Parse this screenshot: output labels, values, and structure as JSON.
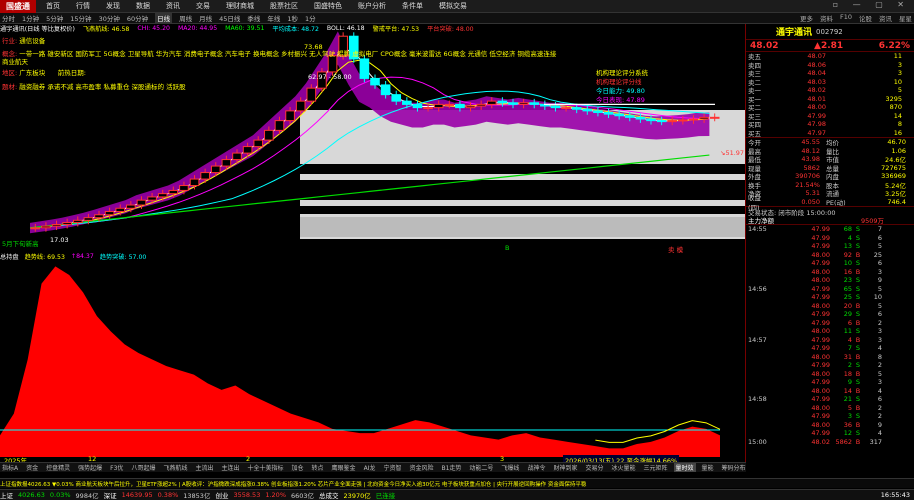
{
  "app": {
    "logo": "国盛通",
    "menus": [
      "首页",
      "行情",
      "发现",
      "数据",
      "资讯",
      "交易",
      "理财商城",
      "股票社区",
      "国盛特色",
      "账户分析",
      "条件单",
      "模拟交易"
    ],
    "controls": "▫ — ▢ ✕"
  },
  "periods": [
    "分时",
    "1分钟",
    "5分钟",
    "15分钟",
    "30分钟",
    "60分钟",
    "日线",
    "周线",
    "月线",
    "45日线",
    "季线",
    "年线",
    "1秒",
    "1分"
  ],
  "active_period": "日线",
  "right_buttons": [
    "更多",
    "资料",
    "F10",
    "论股",
    "资讯",
    "星星"
  ],
  "ma": [
    {
      "text": "通宇通讯(日线 等比复权价)",
      "color": "#ffffff"
    },
    {
      "text": "飞燕航线: 46.58",
      "color": "#ffff00"
    },
    {
      "text": "CHI: 45.20",
      "color": "#ff00ff"
    },
    {
      "text": "MA20: 44.95",
      "color": "#ff00ff"
    },
    {
      "text": "MA60: 39.51",
      "color": "#00ff00"
    },
    {
      "text": "平均成本: 48.72",
      "color": "#00ffff"
    },
    {
      "text": "BOLL: 46.18",
      "color": "#ffffff"
    },
    {
      "text": "警戒平台: 47.53",
      "color": "#ffff00"
    },
    {
      "text": "平台突破: 48.00",
      "color": "#ff3333"
    }
  ],
  "notes": {
    "industry_label": "行业:",
    "industry": "通信设备",
    "concept_label": "概念:",
    "concept": "一带一路 雄安新区 国防军工 5G概念 卫星导航 华为汽车 消费电子概念 汽车电子 换电概念 乡村振兴 无人驾驶 鲲鹏 虚拟电厂 CPO概念 毫米波雷达 6G概念 光通信 低空经济 铜缆高速连接 商业航天",
    "region_label": "地区:",
    "region": "广东板块",
    "hot_label": "前热日期:",
    "hot": "",
    "theme_label": "题材:",
    "theme": "融资融券 承诺不减 高市盈率 私募重仓 深股通标的 活跃股",
    "eval_title": "机构理论评分系统",
    "eval_line1": "今日能力: 49.80",
    "eval_line2": "今日表现: 47.89",
    "peak": "73.68",
    "mid": "62.97 - 58.00",
    "low": "17.03",
    "right_tag": "↘51.97",
    "buy_mark": "B",
    "sell_mark": "卖 模",
    "low_left": "5月下旬新高"
  },
  "y_axis_top": [
    "73.68",
    "69.00",
    "64.00",
    "62.88",
    "59.00",
    "54.00",
    "49.00",
    "44.00",
    "39.00",
    "34.00",
    "29.00",
    "24.00",
    "19.00",
    "14.00",
    "9.00"
  ],
  "y_axis_bottom": [
    "90.00",
    "80.00",
    "70.00",
    "60.00",
    "50.00",
    "40.00",
    "30.00",
    "20.00",
    "10.00"
  ],
  "indicator": [
    {
      "text": "总持盘",
      "color": "#ffffff"
    },
    {
      "text": "趋势线: 69.53",
      "color": "#ffff00"
    },
    {
      "text": "↑84.37",
      "color": "#ff00ff"
    },
    {
      "text": "趋势突破: 57.00",
      "color": "#00ffff"
    }
  ],
  "x_dates": [
    "2025年",
    "12",
    "2",
    "3",
    "4"
  ],
  "date_tag": "2026/03/13(五) 22 至今涨幅14.66%",
  "stock": {
    "name": "通宇通讯",
    "code": "002792",
    "price": "48.02",
    "change": "▲2.81",
    "pct": "6.22%"
  },
  "orderbook": [
    {
      "label": "卖五",
      "price": "48.07",
      "vol": "11"
    },
    {
      "label": "卖四",
      "price": "48.06",
      "vol": "3"
    },
    {
      "label": "卖三",
      "price": "48.04",
      "vol": "3"
    },
    {
      "label": "卖二",
      "price": "48.03",
      "vol": "10"
    },
    {
      "label": "卖一",
      "price": "48.02",
      "vol": "5"
    },
    {
      "label": "买一",
      "price": "48.01",
      "vol": "3295"
    },
    {
      "label": "买二",
      "price": "48.00",
      "vol": "870"
    },
    {
      "label": "买三",
      "price": "47.99",
      "vol": "14"
    },
    {
      "label": "买四",
      "price": "47.98",
      "vol": "8"
    },
    {
      "label": "买五",
      "price": "47.97",
      "vol": "16"
    }
  ],
  "stats": [
    {
      "a": "今开",
      "b": "45.55",
      "c": "均价",
      "d": "46.70"
    },
    {
      "a": "最高",
      "b": "48.12",
      "c": "量比",
      "d": "1.06"
    },
    {
      "a": "最低",
      "b": "43.98",
      "c": "市值",
      "d": "24.6亿"
    },
    {
      "a": "现量",
      "b": "5862",
      "c": "总量",
      "d": "727675"
    },
    {
      "a": "外盘",
      "b": "390706",
      "c": "内盘",
      "d": "336969"
    },
    {
      "a": "换手",
      "b": "21.54%",
      "c": "股本",
      "d": "5.24亿"
    },
    {
      "a": "净资",
      "b": "5.31",
      "c": "流通",
      "d": "3.25亿"
    },
    {
      "a": "收益(四)",
      "b": "0.050",
      "c": "PE(动)",
      "d": "746.4"
    }
  ],
  "trade_status": "交易状态: 闭市阶段 15:00:00",
  "main_net": "主力净额",
  "main_net_val": "9509万",
  "ticks": [
    {
      "t": "14:55",
      "p": "47.99",
      "f": "68",
      "v": "S",
      "n": "7"
    },
    {
      "t": "",
      "p": "47.99",
      "f": "4",
      "v": "S",
      "n": "6"
    },
    {
      "t": "",
      "p": "47.99",
      "f": "13",
      "v": "S",
      "n": "5"
    },
    {
      "t": "",
      "p": "48.00",
      "f": "92",
      "v": "B",
      "n": "25"
    },
    {
      "t": "",
      "p": "47.99",
      "f": "10",
      "v": "S",
      "n": "6"
    },
    {
      "t": "",
      "p": "48.00",
      "f": "16",
      "v": "B",
      "n": "3"
    },
    {
      "t": "",
      "p": "48.00",
      "f": "23",
      "v": "S",
      "n": "9"
    },
    {
      "t": "14:56",
      "p": "47.99",
      "f": "65",
      "v": "S",
      "n": "5"
    },
    {
      "t": "",
      "p": "47.99",
      "f": "25",
      "v": "S",
      "n": "10"
    },
    {
      "t": "",
      "p": "48.00",
      "f": "20",
      "v": "B",
      "n": "5"
    },
    {
      "t": "",
      "p": "47.99",
      "f": "29",
      "v": "S",
      "n": "6"
    },
    {
      "t": "",
      "p": "47.99",
      "f": "6",
      "v": "B",
      "n": "2"
    },
    {
      "t": "",
      "p": "48.00",
      "f": "11",
      "v": "S",
      "n": "3"
    },
    {
      "t": "14:57",
      "p": "47.99",
      "f": "4",
      "v": "B",
      "n": "3"
    },
    {
      "t": "",
      "p": "47.99",
      "f": "7",
      "v": "S",
      "n": "4"
    },
    {
      "t": "",
      "p": "48.00",
      "f": "31",
      "v": "B",
      "n": "8"
    },
    {
      "t": "",
      "p": "47.99",
      "f": "2",
      "v": "S",
      "n": "2"
    },
    {
      "t": "",
      "p": "48.00",
      "f": "18",
      "v": "B",
      "n": "5"
    },
    {
      "t": "",
      "p": "47.99",
      "f": "9",
      "v": "S",
      "n": "3"
    },
    {
      "t": "",
      "p": "48.00",
      "f": "14",
      "v": "B",
      "n": "4"
    },
    {
      "t": "14:58",
      "p": "47.99",
      "f": "21",
      "v": "S",
      "n": "6"
    },
    {
      "t": "",
      "p": "48.00",
      "f": "5",
      "v": "B",
      "n": "2"
    },
    {
      "t": "",
      "p": "47.99",
      "f": "3",
      "v": "S",
      "n": "2"
    },
    {
      "t": "",
      "p": "48.00",
      "f": "36",
      "v": "B",
      "n": "9"
    },
    {
      "t": "",
      "p": "47.99",
      "f": "12",
      "v": "S",
      "n": "4"
    },
    {
      "t": "15:00",
      "p": "48.02",
      "f": "5862",
      "v": "B",
      "n": "317"
    }
  ],
  "tabs": [
    "指标A",
    "资金",
    "控盘精灵",
    "强势起爆",
    "F3优",
    "八哥起爆",
    "飞燕航线",
    "主流出",
    "主连出",
    "十全十美指标",
    "加仓",
    "转点",
    "鹰眼鉴金",
    "AI龙",
    "宁资智",
    "资金风险",
    "B1走势",
    "动能二号",
    "飞爆线",
    "战神令",
    "财神到家",
    "交易分",
    "冰火量能",
    "三元矩阵",
    "量时效",
    "量能",
    "筹码分布",
    "MAC",
    "副图公式1",
    "指标公式",
    "月线量能",
    "金叉",
    "专家指标",
    "日线"
  ],
  "active_tab": "量时效",
  "ticker": "上证指数报4026.63 ▼0.03% 商业航天板块午后拉升，卫星ETF涨超2%  |  A股收评：沪指微跌深成指涨0.38% 创业板指涨1.20% 芯片产业全面走强  |  北向资金今日净买入逾30亿元 电子板块获重点加仓  |  央行开展逆回购操作 资金面保持平稳",
  "indices": [
    {
      "name": "上证",
      "val": "4026.63",
      "chg": "0.03%",
      "color": "#0d0"
    },
    {
      "name": "",
      "val": "9984亿",
      "chg": "",
      "color": "#ccc"
    },
    {
      "name": "深证",
      "val": "14639.95",
      "chg": "0.38%",
      "color": "#f33"
    },
    {
      "name": "",
      "val": "13853亿",
      "chg": "",
      "color": "#ccc"
    },
    {
      "name": "创业",
      "val": "3558.53",
      "chg": "1.20%",
      "color": "#f33"
    },
    {
      "name": "",
      "val": "6603亿",
      "chg": "",
      "color": "#ccc"
    },
    {
      "name": "总成交",
      "val": "23970亿",
      "chg": "",
      "color": "#ff0"
    },
    {
      "name": "",
      "val": "已连接",
      "chg": "",
      "color": "#0d0"
    }
  ],
  "clock": "16:55:43",
  "chart_data": {
    "type": "candlestick+area",
    "title": "通宇通讯(日线 等比复权价)",
    "price_range": [
      9,
      73.68
    ],
    "indicator_range": [
      0,
      90
    ],
    "price_close": [
      14,
      14.5,
      15,
      15.6,
      16.3,
      17.1,
      18,
      19,
      20,
      21,
      22.5,
      23.5,
      24.5,
      25.5,
      27,
      29,
      31,
      33,
      35,
      37,
      39,
      41,
      44,
      47,
      50,
      53,
      57,
      62,
      67,
      73,
      66,
      60,
      58,
      55,
      53,
      52,
      51,
      51,
      52,
      52,
      51,
      51.5,
      52,
      53,
      52.5,
      52,
      52.5,
      52,
      51.5,
      51,
      51,
      50.5,
      50,
      49.5,
      49,
      48.5,
      48,
      47.5,
      47,
      46.8,
      47,
      47.2,
      47.5,
      48,
      48.02
    ],
    "trend_line": [
      10,
      20,
      45,
      80,
      88,
      84,
      76,
      65,
      58,
      52,
      48,
      45,
      42,
      40,
      38,
      34,
      31,
      33,
      29,
      26,
      23,
      20,
      18,
      16,
      13,
      12,
      11,
      11,
      13,
      15,
      17,
      16,
      14,
      12,
      10,
      9,
      8,
      10,
      11,
      9,
      8,
      7,
      6,
      5,
      4,
      4,
      6,
      7,
      9,
      12,
      14,
      13,
      10
    ],
    "trend_breakout": 57
  }
}
